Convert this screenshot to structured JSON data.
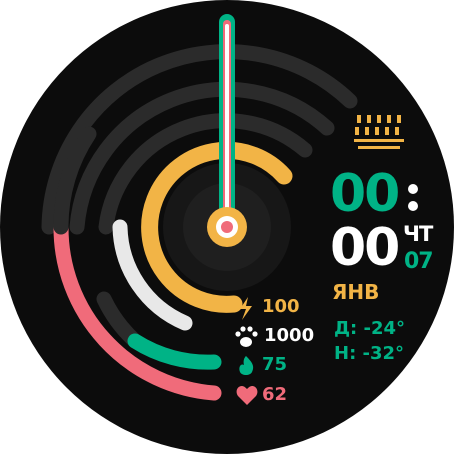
{
  "time": {
    "hour": "00",
    "minute": "00"
  },
  "date": {
    "weekday": "ЧТ",
    "day": "07",
    "month": "ЯНВ"
  },
  "weather": {
    "day_temp": "Д: -24°",
    "night_temp": "Н: -32°"
  },
  "metrics": {
    "energy": "100",
    "steps": "1000",
    "calories": "75",
    "heart_rate": "62"
  },
  "ring_progress": {
    "energy": 0.75,
    "steps": 0.12,
    "calories": 0.2,
    "heart_rate": 0.3
  },
  "icons": {
    "energy": "lightning-icon",
    "steps": "paw-icon",
    "calories": "flame-icon",
    "heart_rate": "heart-icon",
    "weather": "rain-cloud-icon"
  },
  "colors": {
    "background": "#0c0c0c",
    "track": "#2e2e2e",
    "energy": "#f2b446",
    "steps": "#e8e8e8",
    "calories": "#00b386",
    "heart_rate": "#f06b7a",
    "accent_green": "#00b386"
  }
}
